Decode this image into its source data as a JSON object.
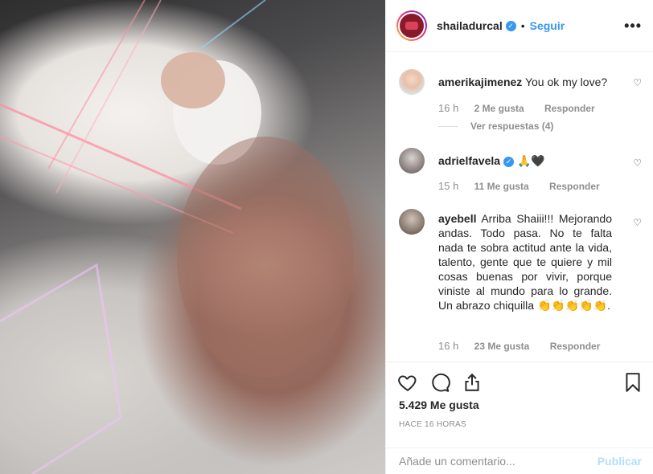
{
  "post": {
    "username": "shailadurcal",
    "follow_label": "Seguir",
    "separator": "•",
    "more_label": "•••",
    "likes": "5.429 Me gusta",
    "timestamp": "HACE 16 HORAS",
    "add_comment_placeholder": "Añade un comentario...",
    "publish_label": "Publicar"
  },
  "comments": [
    {
      "username": "amerikajimenez",
      "text": "You ok my love?",
      "time": "16 h",
      "likes": "2 Me gusta",
      "reply_label": "Responder",
      "view_replies": "Ver respuestas (4)"
    },
    {
      "username": "adrielfavela",
      "text": "🙏🖤",
      "time": "15 h",
      "likes": "11 Me gusta",
      "reply_label": "Responder"
    },
    {
      "username": "ayebell",
      "text": "Arriba Shaiii!!! Mejorando andas. Todo pasa. No te falta nada te sobra actitud ante la vida, talento, gente que te quiere y mil cosas buenas por vivir, porque viniste al mundo para lo grande. Un abrazo chiquilla 👏👏👏👏👏.",
      "time": "16 h",
      "likes": "23 Me gusta",
      "reply_label": "Responder"
    }
  ],
  "icons": {
    "like": "heart-icon",
    "comment": "comment-icon",
    "share": "share-icon",
    "save": "bookmark-icon",
    "verified": "verified-badge-icon",
    "comment_like": "small-heart-icon"
  },
  "colors": {
    "link": "#3897f0",
    "muted": "#8e8e8e",
    "publish_disabled": "#b2dffc"
  }
}
